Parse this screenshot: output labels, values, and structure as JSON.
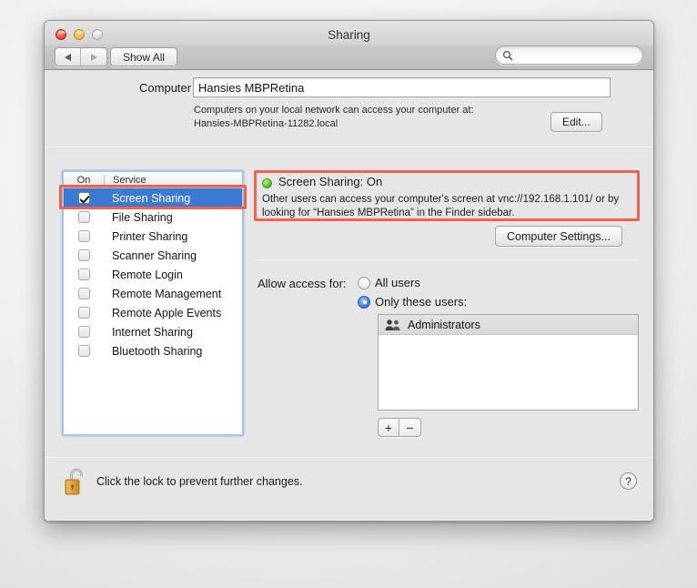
{
  "window": {
    "title": "Sharing",
    "traffic_lights": {
      "close": "close-button",
      "minimize": "minimize-button",
      "zoom": "zoom-button"
    },
    "nav": {
      "back": "◀",
      "forward": "▶"
    },
    "show_all_label": "Show All",
    "search": {
      "value": "",
      "placeholder": ""
    }
  },
  "computer_name": {
    "label": "Computer Name:",
    "value": "Hansies MBPRetina",
    "help_line1": "Computers on your local network can access your computer at:",
    "help_line2": "Hansies-MBPRetina-11282.local",
    "edit_label": "Edit..."
  },
  "services": {
    "header_on": "On",
    "header_service": "Service",
    "items": [
      {
        "label": "Screen Sharing",
        "checked": true,
        "selected": true
      },
      {
        "label": "File Sharing",
        "checked": false,
        "selected": false
      },
      {
        "label": "Printer Sharing",
        "checked": false,
        "selected": false
      },
      {
        "label": "Scanner Sharing",
        "checked": false,
        "selected": false
      },
      {
        "label": "Remote Login",
        "checked": false,
        "selected": false
      },
      {
        "label": "Remote Management",
        "checked": false,
        "selected": false
      },
      {
        "label": "Remote Apple Events",
        "checked": false,
        "selected": false
      },
      {
        "label": "Internet Sharing",
        "checked": false,
        "selected": false
      },
      {
        "label": "Bluetooth Sharing",
        "checked": false,
        "selected": false
      }
    ]
  },
  "status": {
    "title": "Screen Sharing: On",
    "indicator": "green",
    "description": "Other users can access your computer's screen at vnc://192.168.1.101/ or by looking for “Hansies MBPRetina” in the Finder sidebar.",
    "computer_settings_label": "Computer Settings..."
  },
  "access": {
    "label": "Allow access for:",
    "options": [
      {
        "label": "All users",
        "selected": false
      },
      {
        "label": "Only these users:",
        "selected": true
      }
    ],
    "users": [
      {
        "name": "Administrators",
        "icon": "group-icon"
      }
    ],
    "add_label": "+",
    "remove_label": "−"
  },
  "footer": {
    "lock_state": "unlocked",
    "lock_text": "Click the lock to prevent further changes.",
    "help_label": "?"
  },
  "annotation": {
    "color": "#f2604e"
  }
}
